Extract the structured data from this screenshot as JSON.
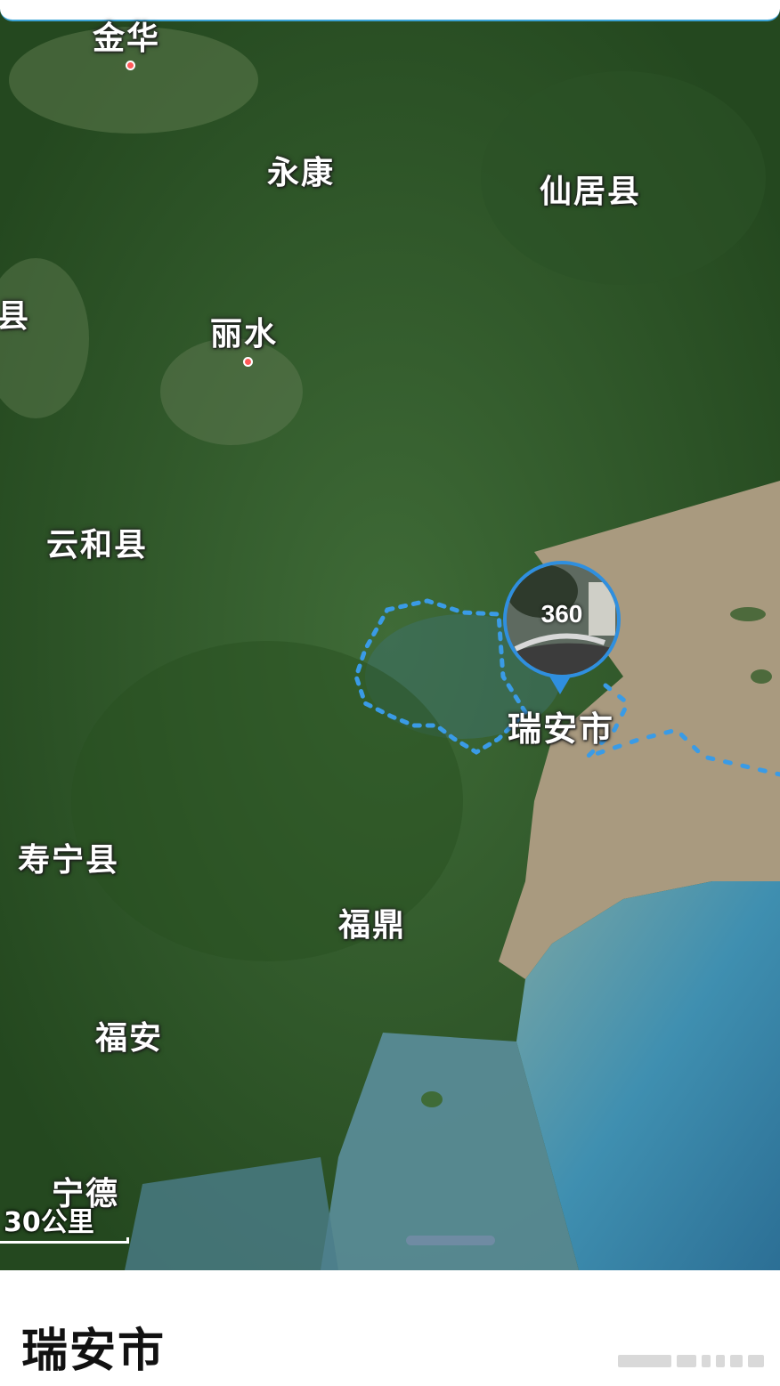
{
  "map": {
    "labels": [
      {
        "id": "jinhua",
        "text": "金华"
      },
      {
        "id": "yongkang",
        "text": "永康"
      },
      {
        "id": "xianju",
        "text": "仙居县"
      },
      {
        "id": "xian-left",
        "text": "县"
      },
      {
        "id": "lishui",
        "text": "丽水"
      },
      {
        "id": "yunhe",
        "text": "云和县"
      },
      {
        "id": "shouning",
        "text": "寿宁县"
      },
      {
        "id": "fuding",
        "text": "福鼎"
      },
      {
        "id": "fuan",
        "text": "福安"
      },
      {
        "id": "ningde",
        "text": "宁德"
      }
    ],
    "selected_place_label": "瑞安市",
    "pano_badge": "360",
    "scale_label": "30公里",
    "colors": {
      "land": "#2f5a2c",
      "sea": "#4f92a6",
      "boundary": "#3a9be6",
      "pin": "#2f8fdf",
      "city_dot": "#ff5a5a"
    }
  },
  "bottom_sheet": {
    "title": "瑞安市"
  }
}
